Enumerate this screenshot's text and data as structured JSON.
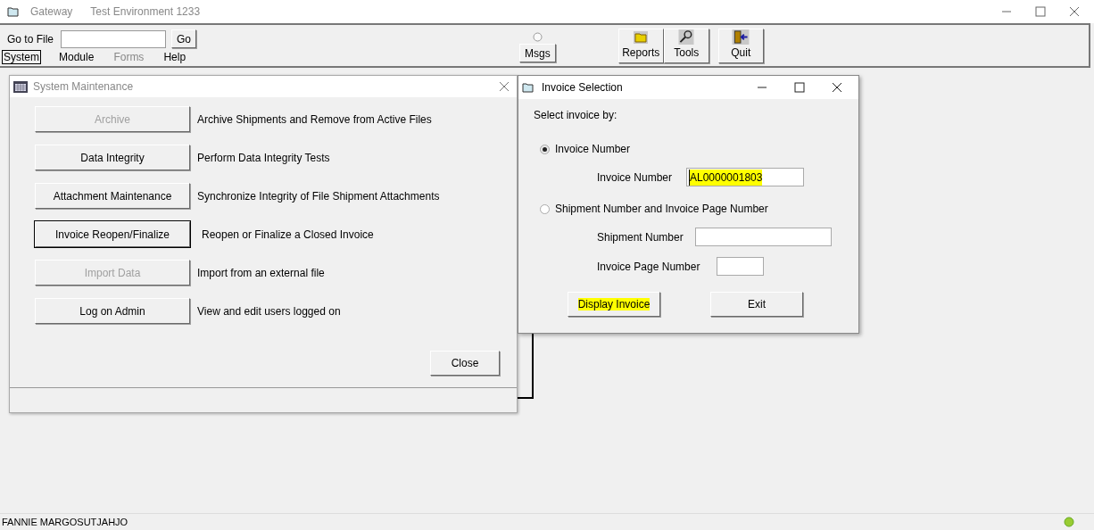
{
  "window": {
    "title": "Gateway",
    "subtitle": "Test Environment 1233"
  },
  "toolbar": {
    "goto_label": "Go to File",
    "go_button": "Go",
    "msgs_button": "Msgs",
    "buttons": [
      {
        "label": "Reports",
        "kind": "reports"
      },
      {
        "label": "Tools",
        "kind": "tools"
      },
      {
        "label": "Quit",
        "kind": "quit"
      }
    ]
  },
  "menu": [
    {
      "label": "System",
      "selected": true,
      "disabled": false
    },
    {
      "label": "Module",
      "selected": false,
      "disabled": false
    },
    {
      "label": "Forms",
      "selected": false,
      "disabled": true
    },
    {
      "label": "Help",
      "selected": false,
      "disabled": false
    }
  ],
  "system_maintenance": {
    "title": "System Maintenance",
    "rows": [
      {
        "button": "Archive",
        "description": "Archive Shipments and Remove from Active Files",
        "disabled": true,
        "focused": false
      },
      {
        "button": "Data Integrity",
        "description": "Perform Data Integrity Tests",
        "disabled": false,
        "focused": false
      },
      {
        "button": "Attachment Maintenance",
        "description": "Synchronize Integrity of File Shipment Attachments",
        "disabled": false,
        "focused": false
      },
      {
        "button": "Invoice Reopen/Finalize",
        "description": "Reopen or Finalize a Closed Invoice",
        "disabled": false,
        "focused": true
      },
      {
        "button": "Import Data",
        "description": "Import from an external file",
        "disabled": true,
        "focused": false
      },
      {
        "button": "Log on Admin",
        "description": "View and edit users logged on",
        "disabled": false,
        "focused": false
      }
    ],
    "close_button": "Close"
  },
  "invoice_selection": {
    "title": "Invoice Selection",
    "prompt": "Select invoice by:",
    "options": [
      {
        "label": "Invoice Number",
        "selected": true,
        "fields": [
          {
            "label": "Invoice Number",
            "value": "AL0000001803",
            "highlighted": true
          }
        ]
      },
      {
        "label": "Shipment Number and Invoice Page Number",
        "selected": false,
        "fields": [
          {
            "label": "Shipment Number"
          },
          {
            "label": "Invoice Page Number"
          }
        ]
      }
    ],
    "buttons": [
      {
        "label": "Display Invoice",
        "highlighted": true
      },
      {
        "label": "Exit",
        "highlighted": false
      }
    ]
  },
  "status_bar": {
    "user": "FANNIE MARGOSUTJAHJO"
  }
}
